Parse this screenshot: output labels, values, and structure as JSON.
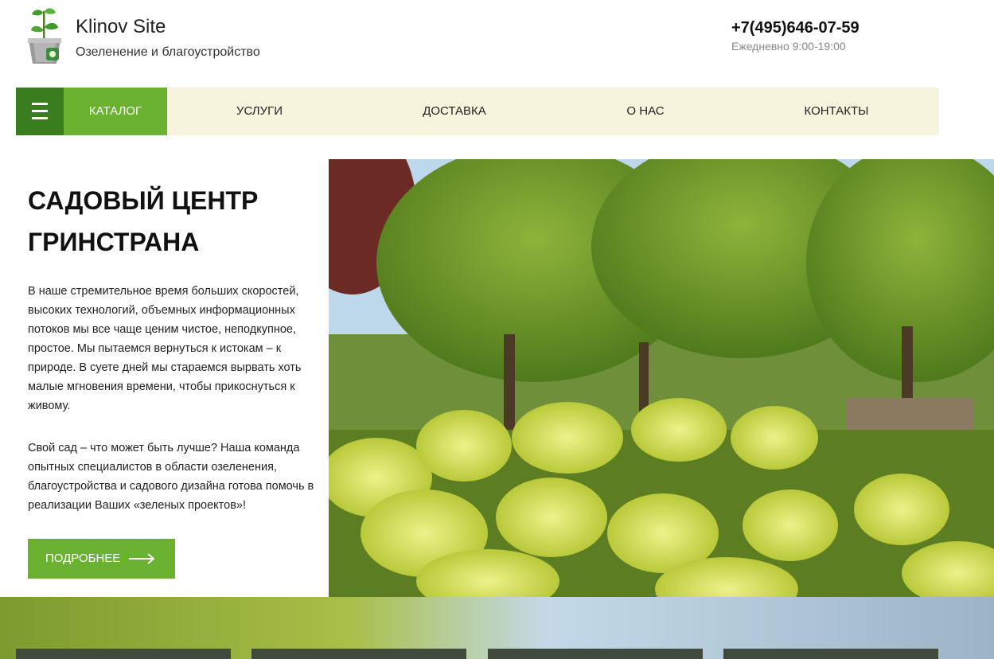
{
  "header": {
    "site_name": "Klinov Site",
    "tagline": "Озеленение и благоустройство",
    "phone": "+7(495)646-07-59",
    "hours": "Ежедневно 9:00-19:00"
  },
  "nav": {
    "catalog": "КАТАЛОГ",
    "items": [
      "УСЛУГИ",
      "ДОСТАВКА",
      "О НАС",
      "КОНТАКТЫ"
    ]
  },
  "hero": {
    "title": "САДОВЫЙ ЦЕНТР ГРИНСТРАНА",
    "paragraph1": "В наше стремительное время больших скоростей, высоких технологий, объемных информационных потоков мы все чаще ценим чистое, неподкупное, простое. Мы пытаемся вернуться к истокам – к природе. В суете дней мы стараемся вырвать хоть малые мгновения времени, чтобы прикоснуться к живому.",
    "paragraph2": "Свой сад – что может быть лучше? Наша команда опытных специалистов в области озеленения, благоустройства и садового дизайна готова помочь в реализации Ваших «зеленых проектов»!",
    "button": "ПОДРОБНЕЕ"
  },
  "colors": {
    "accent_green": "#6ab12f",
    "dark_green": "#3a7d1e",
    "nav_bg": "#f7f4dd"
  }
}
